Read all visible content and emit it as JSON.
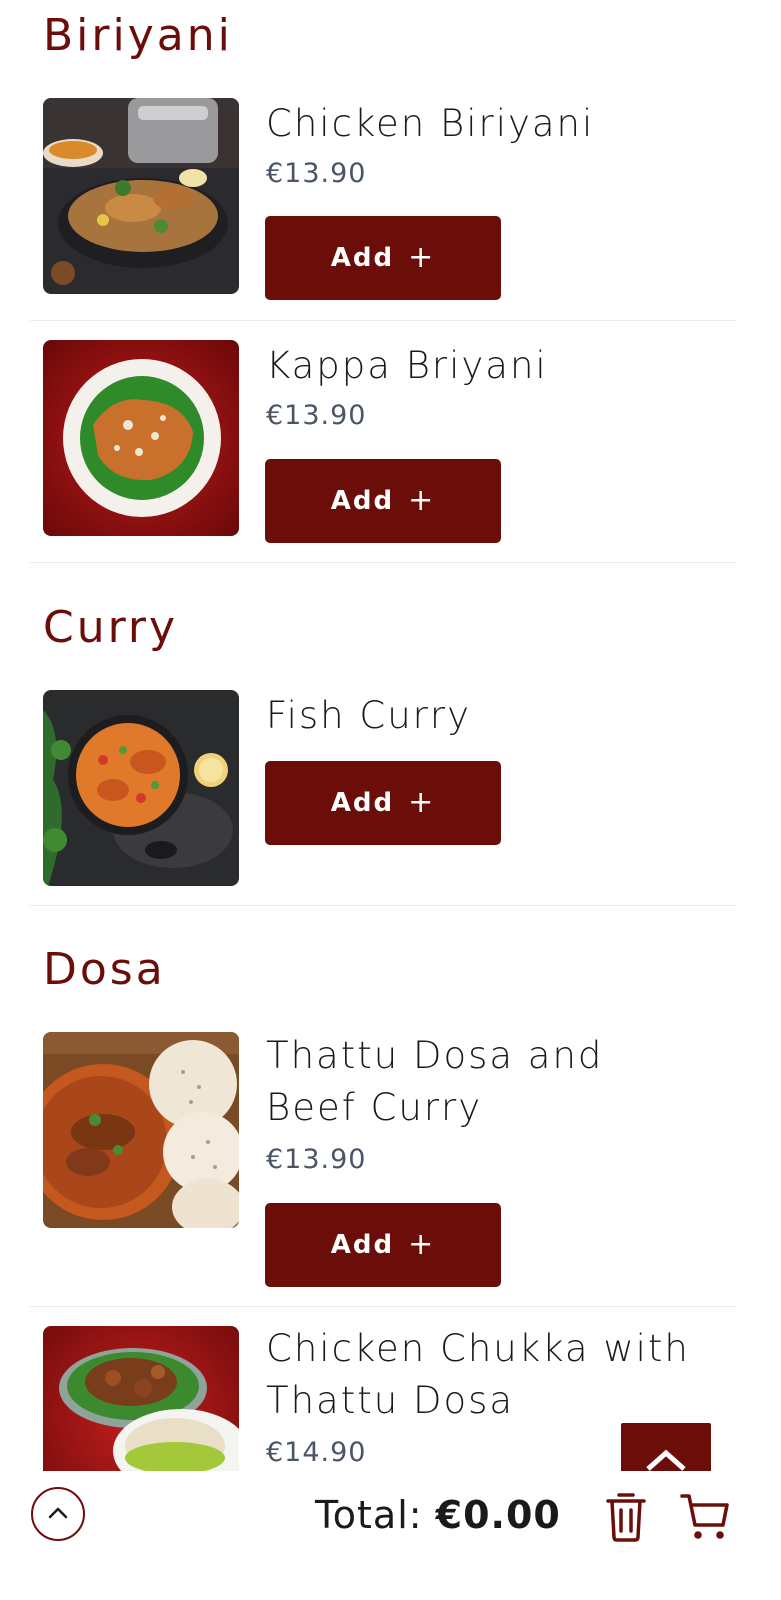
{
  "colors": {
    "accent": "#6b0e0a",
    "price": "#4a5565",
    "divider": "#ececec"
  },
  "menu": {
    "categories": [
      {
        "title": "Biriyani",
        "items": [
          {
            "name": "Chicken Biriyani",
            "price": "€13.90",
            "button": "Add",
            "image": "chicken-biriyani-photo"
          },
          {
            "name": "Kappa Briyani",
            "price": "€13.90",
            "button": "Add",
            "image": "kappa-biriyani-photo"
          }
        ]
      },
      {
        "title": "Curry",
        "items": [
          {
            "name": "Fish Curry",
            "button": "Add",
            "image": "fish-curry-photo"
          }
        ]
      },
      {
        "title": "Dosa",
        "items": [
          {
            "name_lines": [
              "Thattu Dosa and",
              "Beef Curry"
            ],
            "price": "€13.90",
            "button": "Add",
            "image": "thattu-dosa-beef-photo"
          },
          {
            "name_lines": [
              "Chicken Chukka with",
              "Thattu Dosa"
            ],
            "price": "€14.90",
            "image": "chicken-chukka-photo"
          }
        ]
      }
    ]
  },
  "footer": {
    "total_label": "Total:",
    "total_value": "€0.00",
    "icons": [
      "scroll-up-icon",
      "trash-icon",
      "cart-icon"
    ]
  }
}
